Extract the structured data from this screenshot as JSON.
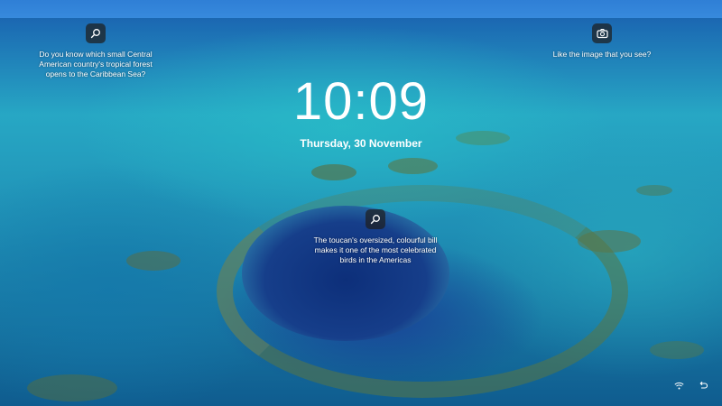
{
  "lockscreen": {
    "time": "10:09",
    "date": "Thursday, 30 November"
  },
  "tips": {
    "top_left": {
      "icon": "search-icon",
      "text_lines": [
        "Do you know which small Central",
        "American country's tropical forest",
        "opens to the Caribbean Sea?"
      ]
    },
    "top_right": {
      "icon": "camera-icon",
      "text": "Like the image that you see?"
    },
    "center": {
      "icon": "search-icon",
      "text_lines": [
        "The toucan's oversized, colourful bill",
        "makes it one of the most celebrated",
        "birds in the Americas"
      ]
    }
  },
  "status_icons": [
    "wifi-icon",
    "restart-icon"
  ]
}
